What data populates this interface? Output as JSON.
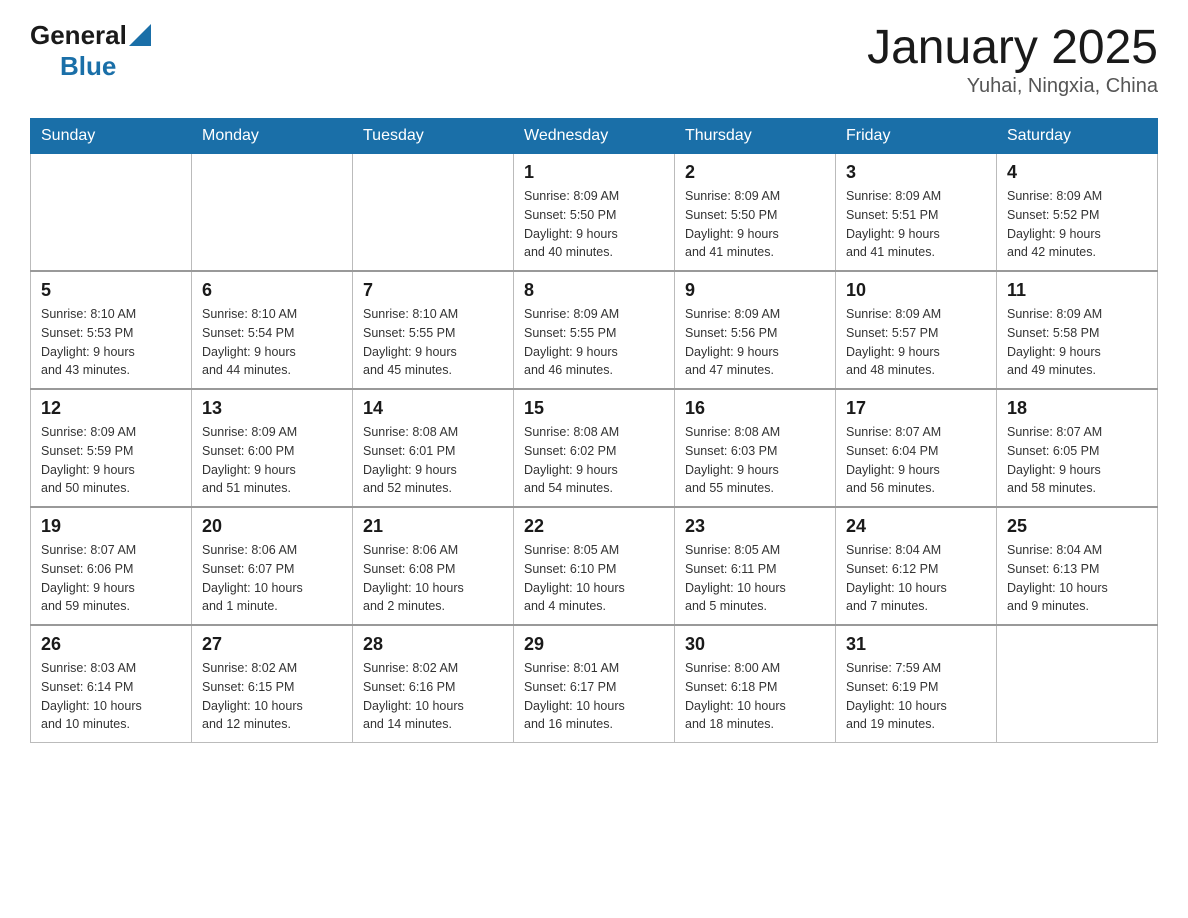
{
  "header": {
    "logo_general": "General",
    "logo_blue": "Blue",
    "title": "January 2025",
    "subtitle": "Yuhai, Ningxia, China"
  },
  "weekdays": [
    "Sunday",
    "Monday",
    "Tuesday",
    "Wednesday",
    "Thursday",
    "Friday",
    "Saturday"
  ],
  "weeks": [
    [
      {
        "day": "",
        "info": ""
      },
      {
        "day": "",
        "info": ""
      },
      {
        "day": "",
        "info": ""
      },
      {
        "day": "1",
        "info": "Sunrise: 8:09 AM\nSunset: 5:50 PM\nDaylight: 9 hours\nand 40 minutes."
      },
      {
        "day": "2",
        "info": "Sunrise: 8:09 AM\nSunset: 5:50 PM\nDaylight: 9 hours\nand 41 minutes."
      },
      {
        "day": "3",
        "info": "Sunrise: 8:09 AM\nSunset: 5:51 PM\nDaylight: 9 hours\nand 41 minutes."
      },
      {
        "day": "4",
        "info": "Sunrise: 8:09 AM\nSunset: 5:52 PM\nDaylight: 9 hours\nand 42 minutes."
      }
    ],
    [
      {
        "day": "5",
        "info": "Sunrise: 8:10 AM\nSunset: 5:53 PM\nDaylight: 9 hours\nand 43 minutes."
      },
      {
        "day": "6",
        "info": "Sunrise: 8:10 AM\nSunset: 5:54 PM\nDaylight: 9 hours\nand 44 minutes."
      },
      {
        "day": "7",
        "info": "Sunrise: 8:10 AM\nSunset: 5:55 PM\nDaylight: 9 hours\nand 45 minutes."
      },
      {
        "day": "8",
        "info": "Sunrise: 8:09 AM\nSunset: 5:55 PM\nDaylight: 9 hours\nand 46 minutes."
      },
      {
        "day": "9",
        "info": "Sunrise: 8:09 AM\nSunset: 5:56 PM\nDaylight: 9 hours\nand 47 minutes."
      },
      {
        "day": "10",
        "info": "Sunrise: 8:09 AM\nSunset: 5:57 PM\nDaylight: 9 hours\nand 48 minutes."
      },
      {
        "day": "11",
        "info": "Sunrise: 8:09 AM\nSunset: 5:58 PM\nDaylight: 9 hours\nand 49 minutes."
      }
    ],
    [
      {
        "day": "12",
        "info": "Sunrise: 8:09 AM\nSunset: 5:59 PM\nDaylight: 9 hours\nand 50 minutes."
      },
      {
        "day": "13",
        "info": "Sunrise: 8:09 AM\nSunset: 6:00 PM\nDaylight: 9 hours\nand 51 minutes."
      },
      {
        "day": "14",
        "info": "Sunrise: 8:08 AM\nSunset: 6:01 PM\nDaylight: 9 hours\nand 52 minutes."
      },
      {
        "day": "15",
        "info": "Sunrise: 8:08 AM\nSunset: 6:02 PM\nDaylight: 9 hours\nand 54 minutes."
      },
      {
        "day": "16",
        "info": "Sunrise: 8:08 AM\nSunset: 6:03 PM\nDaylight: 9 hours\nand 55 minutes."
      },
      {
        "day": "17",
        "info": "Sunrise: 8:07 AM\nSunset: 6:04 PM\nDaylight: 9 hours\nand 56 minutes."
      },
      {
        "day": "18",
        "info": "Sunrise: 8:07 AM\nSunset: 6:05 PM\nDaylight: 9 hours\nand 58 minutes."
      }
    ],
    [
      {
        "day": "19",
        "info": "Sunrise: 8:07 AM\nSunset: 6:06 PM\nDaylight: 9 hours\nand 59 minutes."
      },
      {
        "day": "20",
        "info": "Sunrise: 8:06 AM\nSunset: 6:07 PM\nDaylight: 10 hours\nand 1 minute."
      },
      {
        "day": "21",
        "info": "Sunrise: 8:06 AM\nSunset: 6:08 PM\nDaylight: 10 hours\nand 2 minutes."
      },
      {
        "day": "22",
        "info": "Sunrise: 8:05 AM\nSunset: 6:10 PM\nDaylight: 10 hours\nand 4 minutes."
      },
      {
        "day": "23",
        "info": "Sunrise: 8:05 AM\nSunset: 6:11 PM\nDaylight: 10 hours\nand 5 minutes."
      },
      {
        "day": "24",
        "info": "Sunrise: 8:04 AM\nSunset: 6:12 PM\nDaylight: 10 hours\nand 7 minutes."
      },
      {
        "day": "25",
        "info": "Sunrise: 8:04 AM\nSunset: 6:13 PM\nDaylight: 10 hours\nand 9 minutes."
      }
    ],
    [
      {
        "day": "26",
        "info": "Sunrise: 8:03 AM\nSunset: 6:14 PM\nDaylight: 10 hours\nand 10 minutes."
      },
      {
        "day": "27",
        "info": "Sunrise: 8:02 AM\nSunset: 6:15 PM\nDaylight: 10 hours\nand 12 minutes."
      },
      {
        "day": "28",
        "info": "Sunrise: 8:02 AM\nSunset: 6:16 PM\nDaylight: 10 hours\nand 14 minutes."
      },
      {
        "day": "29",
        "info": "Sunrise: 8:01 AM\nSunset: 6:17 PM\nDaylight: 10 hours\nand 16 minutes."
      },
      {
        "day": "30",
        "info": "Sunrise: 8:00 AM\nSunset: 6:18 PM\nDaylight: 10 hours\nand 18 minutes."
      },
      {
        "day": "31",
        "info": "Sunrise: 7:59 AM\nSunset: 6:19 PM\nDaylight: 10 hours\nand 19 minutes."
      },
      {
        "day": "",
        "info": ""
      }
    ]
  ]
}
